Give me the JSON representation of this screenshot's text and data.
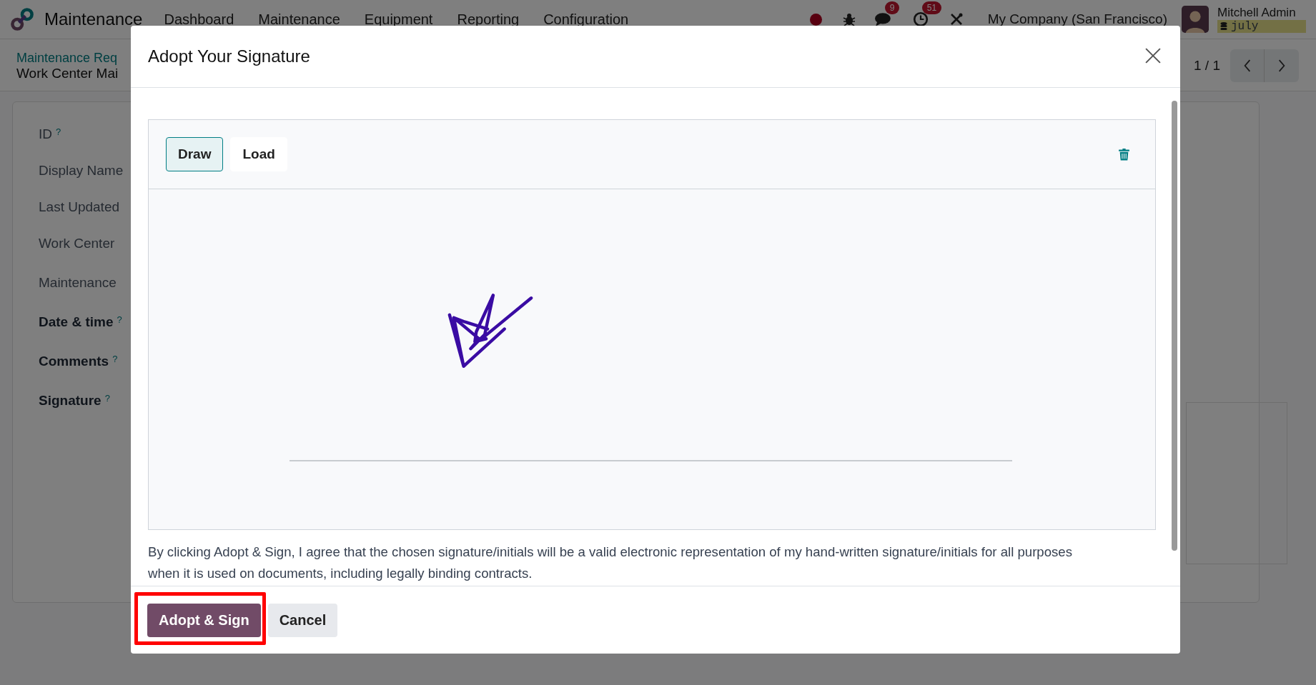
{
  "navbar": {
    "app_name": "Maintenance",
    "menu": [
      "Dashboard",
      "Maintenance",
      "Equipment",
      "Reporting",
      "Configuration"
    ],
    "systray": [
      {
        "kind": "dot"
      },
      {
        "kind": "bug"
      },
      {
        "kind": "chat",
        "badge": "9"
      },
      {
        "kind": "activity",
        "badge": "51"
      },
      {
        "kind": "tools"
      }
    ],
    "company": "My Company (San Francisco)",
    "user": {
      "name": "Mitchell Admin",
      "database": "july"
    }
  },
  "breadcrumb": {
    "parent": "Maintenance Req",
    "current": "Work Center Mai"
  },
  "pager": "1 / 1",
  "form": {
    "fields": [
      {
        "label": "ID",
        "bold": false,
        "help": "?"
      },
      {
        "label": "Display Name",
        "bold": false
      },
      {
        "label": "Last Updated",
        "bold": false
      },
      {
        "label": "Work Center",
        "bold": false
      },
      {
        "label": "Maintenance",
        "bold": false
      },
      {
        "label": "Date & time",
        "bold": true,
        "help": "?"
      },
      {
        "label": "Comments",
        "bold": true,
        "help": "?"
      },
      {
        "label": "Signature",
        "bold": true,
        "help": "?"
      }
    ]
  },
  "dialog": {
    "title": "Adopt Your Signature",
    "tabs": [
      {
        "label": "Draw",
        "selected": true
      },
      {
        "label": "Load",
        "selected": false
      }
    ],
    "disclaimer": "By clicking Adopt & Sign, I agree that the chosen signature/initials will be a valid electronic representation of my hand-written signature/initials for all purposes when it is used on documents, including legally binding contracts.",
    "buttons": [
      {
        "label": "Adopt & Sign",
        "kind": "primary",
        "highlighted": true
      },
      {
        "label": "Cancel",
        "kind": "secondary",
        "highlighted": false
      }
    ]
  }
}
